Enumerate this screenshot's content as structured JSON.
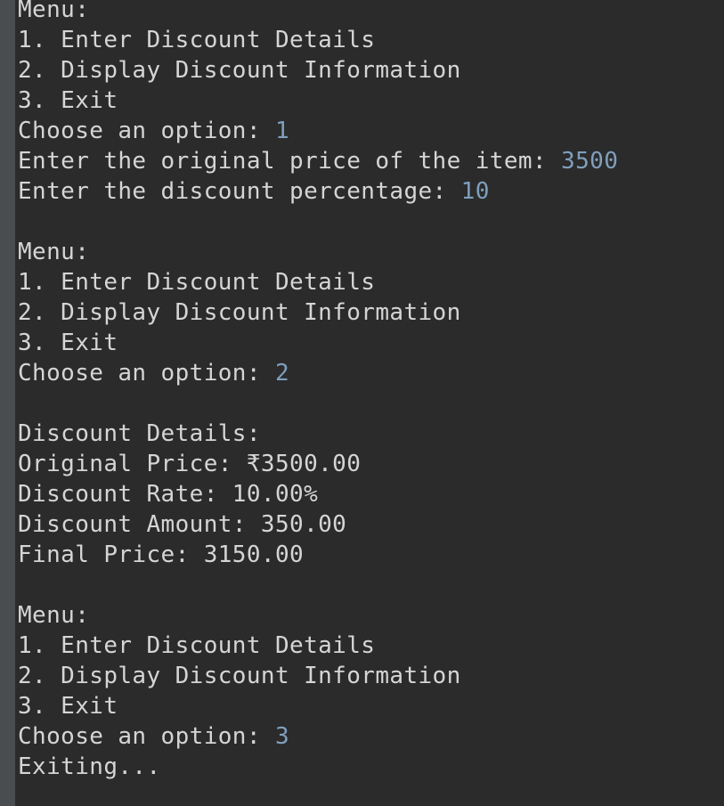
{
  "lines": [
    {
      "text": "Menu:"
    },
    {
      "text": "1. Enter Discount Details"
    },
    {
      "text": "2. Display Discount Information"
    },
    {
      "text": "3. Exit"
    },
    {
      "text": "Choose an option: ",
      "input": "1"
    },
    {
      "text": "Enter the original price of the item: ",
      "input": "3500"
    },
    {
      "text": "Enter the discount percentage: ",
      "input": "10"
    },
    {
      "text": ""
    },
    {
      "text": "Menu:"
    },
    {
      "text": "1. Enter Discount Details"
    },
    {
      "text": "2. Display Discount Information"
    },
    {
      "text": "3. Exit"
    },
    {
      "text": "Choose an option: ",
      "input": "2"
    },
    {
      "text": ""
    },
    {
      "text": "Discount Details:"
    },
    {
      "text": "Original Price: ₹3500.00"
    },
    {
      "text": "Discount Rate: 10.00%"
    },
    {
      "text": "Discount Amount: 350.00"
    },
    {
      "text": "Final Price: 3150.00"
    },
    {
      "text": ""
    },
    {
      "text": "Menu:"
    },
    {
      "text": "1. Enter Discount Details"
    },
    {
      "text": "2. Display Discount Information"
    },
    {
      "text": "3. Exit"
    },
    {
      "text": "Choose an option: ",
      "input": "3"
    },
    {
      "text": "Exiting..."
    }
  ],
  "colors": {
    "background": "#2b2b2b",
    "gutter": "#4a4d50",
    "output_text": "#d5d5d5",
    "user_input": "#7f9fbd"
  }
}
